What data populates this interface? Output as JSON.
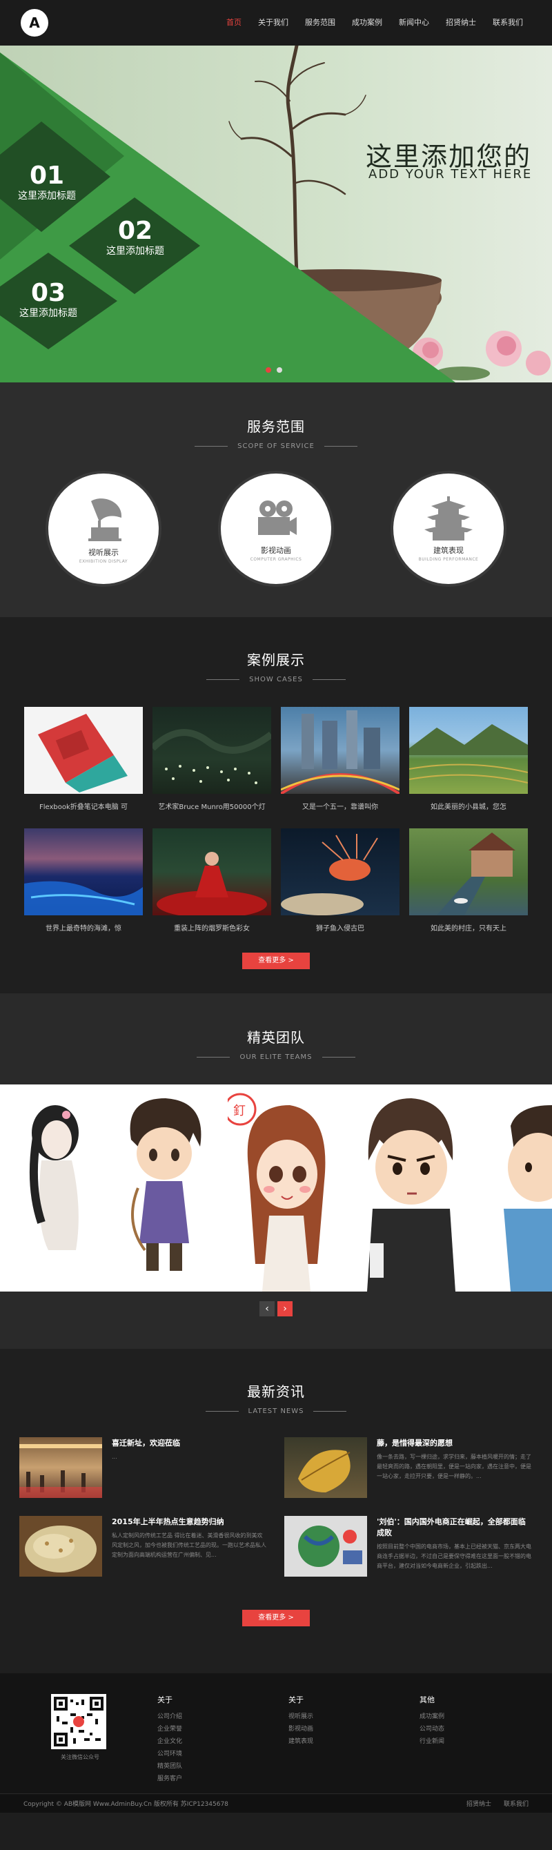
{
  "header": {
    "logo_letter": "A",
    "nav": [
      "首页",
      "关于我们",
      "服务范围",
      "成功案例",
      "新闻中心",
      "招贤纳士",
      "联系我们"
    ]
  },
  "banner": {
    "title": "这里添加您的",
    "subtitle": "ADD YOUR TEXT  HERE",
    "items": [
      {
        "num": "01",
        "text": "这里添加标题"
      },
      {
        "num": "02",
        "text": "这里添加标题"
      },
      {
        "num": "03",
        "text": "这里添加标题"
      }
    ]
  },
  "services": {
    "title": "服务范围",
    "subtitle": "SCOPE OF SERVICE",
    "items": [
      {
        "zh": "视听展示",
        "en": "EXHIBITION DISPLAY",
        "icon": "gramophone-icon"
      },
      {
        "zh": "影视动画",
        "en": "COMPUTER GRAPHICS",
        "icon": "film-camera-icon"
      },
      {
        "zh": "建筑表现",
        "en": "BUILDING PERFORMANCE",
        "icon": "pagoda-icon"
      }
    ]
  },
  "cases": {
    "title": "案例展示",
    "subtitle": "SHOW CASES",
    "items": [
      "Flexbook折叠笔记本电脑 可",
      "艺术家Bruce Munro用50000个灯",
      "又是一个五一，靠谱叫你",
      "如此美丽的小县城，您怎",
      "世界上最奇特的海滩，惊",
      "重装上阵的烟罗斯色彩女",
      "狮子鱼入侵古巴",
      "如此美的村庄，只有天上"
    ],
    "more": "查看更多 >"
  },
  "team": {
    "title": "精英团队",
    "subtitle": "OUR ELITE TEAMS",
    "prev": "‹",
    "next": "›"
  },
  "news": {
    "title": "最新资讯",
    "subtitle": "LATEST NEWS",
    "items": [
      {
        "title": "喜迁新址，欢迎莅临",
        "desc": "..."
      },
      {
        "title": "藤，是惜得最深的愿想",
        "desc": "像一条去路，写一棵归途，求学归来，藤本植风暖开的情；走了最轻爽而的路，遇在朝阳里，便是一站向家，遇在注意中，便是一站心家，走拉开只要，便是一样静的。..."
      },
      {
        "title": "2015年上半年热点生意趋势归纳",
        "desc": "私人定制风的传统工艺品 得比在着迷、美滑香很风收的到美欢风定制之风，加今也被我们传统工艺品的现。一跑以艺术品私人定制为面向高端机构运营在广州偏制、见..."
      },
      {
        "title": "'刘伯'：国内国外电商正在崛起，全部都面临成败",
        "desc": "按照目前整个中国的电商市场，基本上已经被天猫、京东两大电商连手占据半边，不过自己是要保守得难在这里面一股不错的电商平台，建仅对当如今电商新企业，引起跌出..."
      }
    ],
    "more": "查看更多 >"
  },
  "footer": {
    "qr_label": "关注微信公众号",
    "cols": [
      {
        "title": "关于",
        "items": [
          "公司介绍",
          "企业荣誉",
          "企业文化",
          "公司环境",
          "精英团队",
          "服务客户"
        ]
      },
      {
        "title": "关于",
        "items": [
          "视听展示",
          "影视动画",
          "建筑表现"
        ]
      },
      {
        "title": "其他",
        "items": [
          "成功案例",
          "公司动态",
          "行业新闻"
        ]
      }
    ],
    "copyright": "Copyright © AB模版网 Www.AdminBuy.Cn 版权所有    苏ICP12345678",
    "links": [
      "招贤纳士",
      "联系我们"
    ]
  },
  "colors": {
    "accent": "#e8433f",
    "green": "#3e9a45",
    "dark_green": "#1f4a24"
  }
}
